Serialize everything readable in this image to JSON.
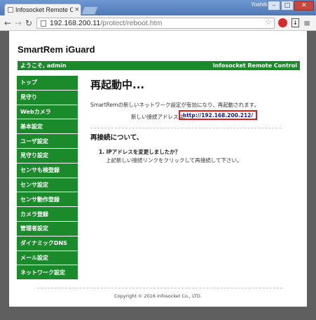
{
  "browser": {
    "tab_title": "Infosocket Remote Co",
    "user_name": "Yoshihiko",
    "url_host": "192.168.200.11",
    "url_path": "/protect/reboot.htm"
  },
  "site": {
    "brand": "SmartRem iGuard",
    "welcome": "ようこそ, admin",
    "product": "Infosocket Remote Control"
  },
  "sidebar": {
    "items": [
      {
        "label": "トップ"
      },
      {
        "label": "見守り"
      },
      {
        "label": "Webカメラ"
      },
      {
        "label": "基本設定"
      },
      {
        "label": "ユーザ設定"
      },
      {
        "label": "見守り設定"
      },
      {
        "label": "センサも検登録"
      },
      {
        "label": "センサ設定"
      },
      {
        "label": "センサ動作登録"
      },
      {
        "label": "カメラ登録"
      },
      {
        "label": "管理者設定"
      },
      {
        "label": "ダイナミックDNS"
      },
      {
        "label": "メール設定"
      },
      {
        "label": "ネットワーク設定"
      }
    ]
  },
  "main": {
    "title": "再起動中...",
    "message": "SmartRemの新しいネットワーク設定が有効になり、再起動されます。",
    "new_address_label": "新しい接続アドレスは:",
    "new_address_link": "http://192.168.200.212/",
    "reconnect_heading": "再接続について、",
    "question_number": "1.",
    "question_text": "IPアドレスを変更しましたか？",
    "answer": "上記新しい接続リンクをクリックして再接続して下さい。"
  },
  "footer": {
    "copyright": "Copyright © 2016 Infosocket Co., LTD."
  }
}
